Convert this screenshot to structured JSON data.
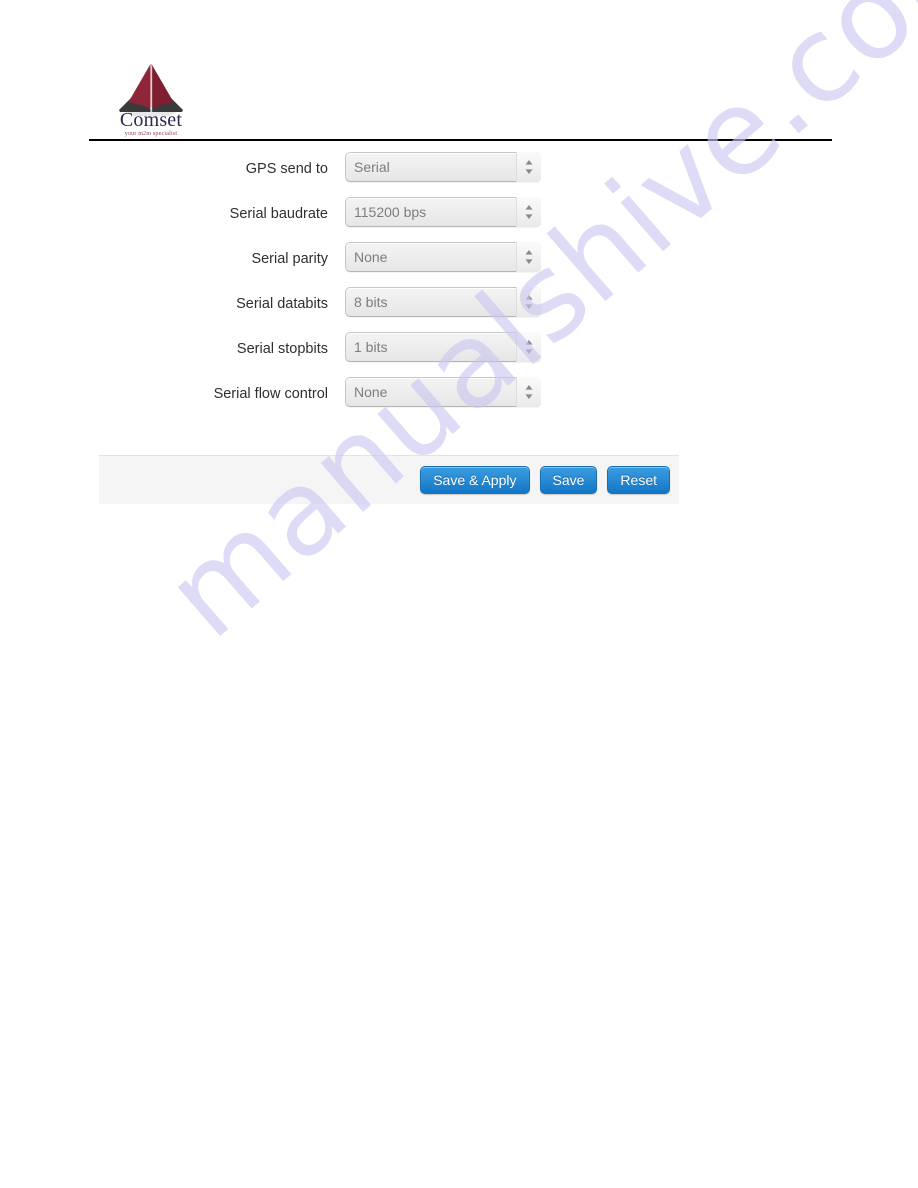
{
  "brand": {
    "name": "Comset",
    "tagline": "your m2m specialist",
    "mark_icon": "comset-pyramid-logo-icon",
    "colors": {
      "mark_red": "#8e2539",
      "mark_dark": "#3a3a3a",
      "wordmark": "#2b2b4e",
      "tagline": "#8e3b4c"
    }
  },
  "watermark": {
    "text": "manualshive.com",
    "color": "#c9c6ef"
  },
  "panel": {
    "fields": [
      {
        "label": "GPS send to",
        "value": "Serial",
        "icon": "select-spinner-icon"
      },
      {
        "label": "Serial baudrate",
        "value": "115200 bps",
        "icon": "select-spinner-icon"
      },
      {
        "label": "Serial parity",
        "value": "None",
        "icon": "select-spinner-icon"
      },
      {
        "label": "Serial databits",
        "value": "8 bits",
        "icon": "select-spinner-icon"
      },
      {
        "label": "Serial stopbits",
        "value": "1 bits",
        "icon": "select-spinner-icon"
      },
      {
        "label": "Serial flow control",
        "value": "None",
        "icon": "select-spinner-icon"
      }
    ],
    "footer": {
      "buttons": [
        {
          "label": "Save & Apply",
          "name": "save-and-apply-button"
        },
        {
          "label": "Save",
          "name": "save-button"
        },
        {
          "label": "Reset",
          "name": "reset-button"
        }
      ],
      "button_color": "#1176c6"
    }
  }
}
